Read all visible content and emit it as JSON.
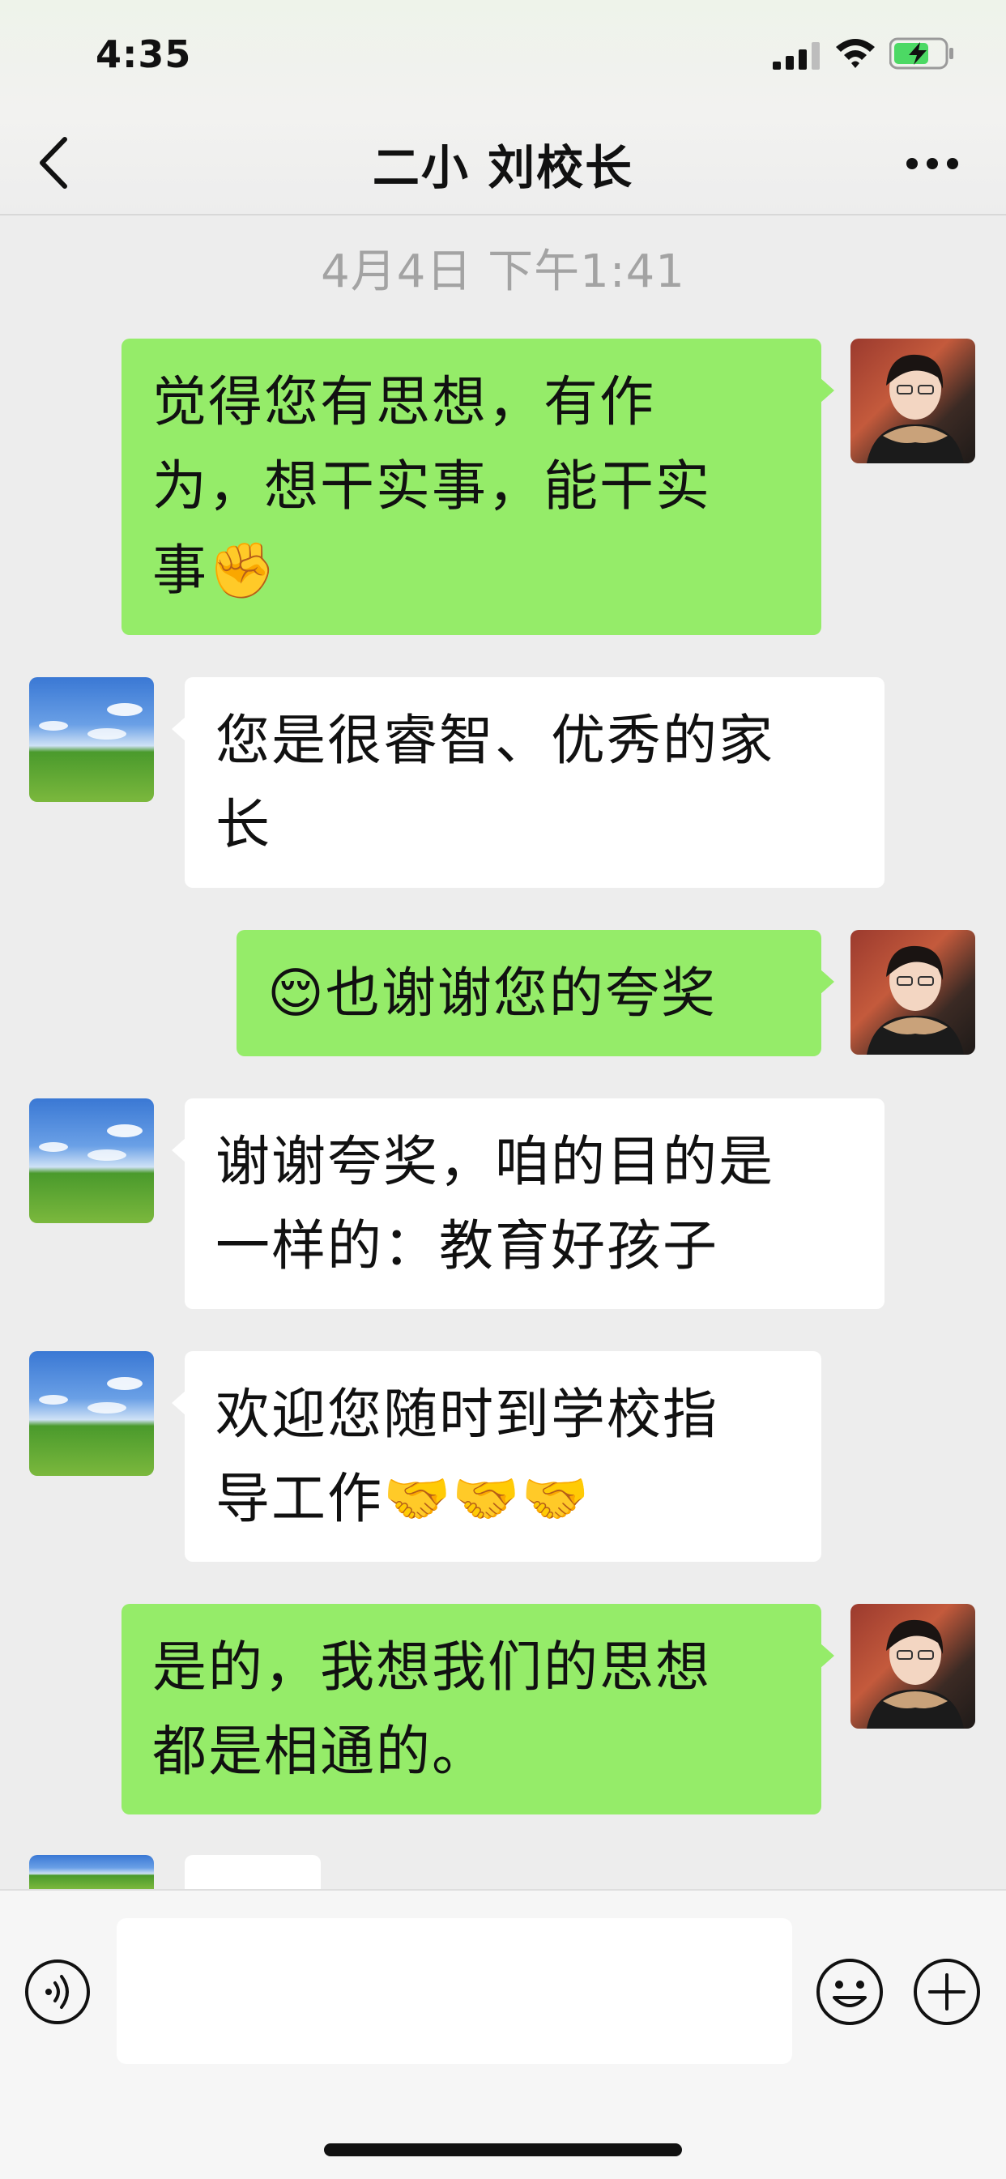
{
  "status_bar": {
    "time": "4:35"
  },
  "header": {
    "title": "二小 刘校长"
  },
  "chat": {
    "timestamp": "4月4日 下午1:41",
    "messages": [
      {
        "sender": "me",
        "text": "觉得您有思想，有作\n为，想干实事，能干实\n事✊"
      },
      {
        "sender": "other",
        "text": "您是很睿智、优秀的家\n长"
      },
      {
        "sender": "me",
        "text": "😌也谢谢您的夸奖"
      },
      {
        "sender": "other",
        "text": "谢谢夸奖，咱的目的是\n一样的：教育好孩子"
      },
      {
        "sender": "other",
        "text": "欢迎您随时到学校指\n导工作🤝🤝🤝"
      },
      {
        "sender": "me",
        "text": "是的，我想我们的思想\n都是相通的。"
      }
    ]
  },
  "input_bar": {
    "value": ""
  },
  "colors": {
    "self_bubble": "#95ec69",
    "other_bubble": "#ffffff",
    "background": "#ededed"
  }
}
